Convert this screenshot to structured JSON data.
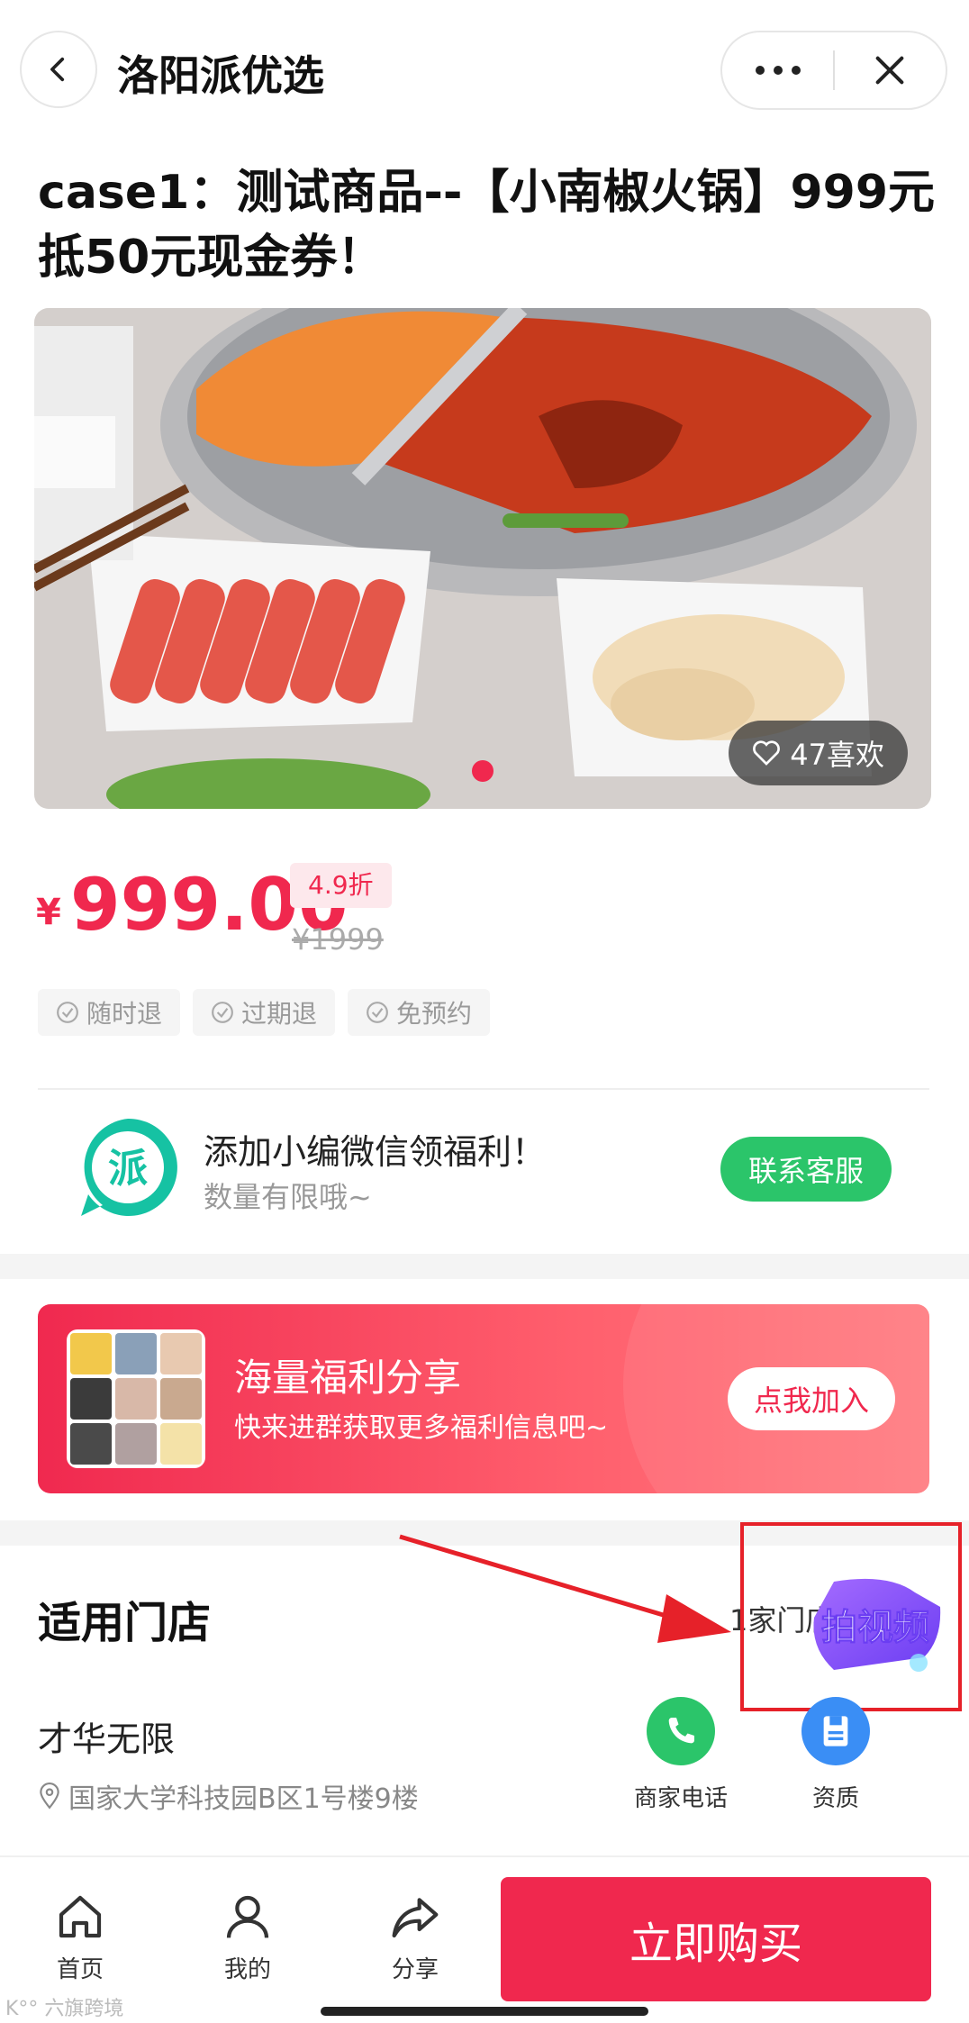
{
  "header": {
    "title": "洛阳派优选"
  },
  "product": {
    "title": "case1：测试商品--【小南椒火锅】999元抵50元现金券！",
    "likes": "47喜欢",
    "currency": "¥",
    "price": "999.00",
    "discount": "4.9折",
    "original_price": "¥1999",
    "tags": [
      "随时退",
      "过期退",
      "免预约"
    ]
  },
  "wechat": {
    "title": "添加小编微信领福利！",
    "subtitle": "数量有限哦~",
    "button": "联系客服",
    "logo_text": "派"
  },
  "banner": {
    "title": "海量福利分享",
    "subtitle": "快来进群获取更多福利信息吧~",
    "button": "点我加入"
  },
  "stores": {
    "title": "适用门店",
    "count": "1家门店",
    "video_sticker": "拍视频",
    "store_name": "才华无限",
    "address": "国家大学科技园B区1号楼9楼",
    "actions": [
      "商家电话",
      "资质"
    ]
  },
  "bottom_nav": {
    "home": "首页",
    "mine": "我的",
    "share": "分享",
    "buy": "立即购买"
  },
  "watermark": "K°° 六旗跨境",
  "colors": {
    "accent": "#f0284e",
    "green": "#2bc56a",
    "annotation": "#e62129"
  }
}
